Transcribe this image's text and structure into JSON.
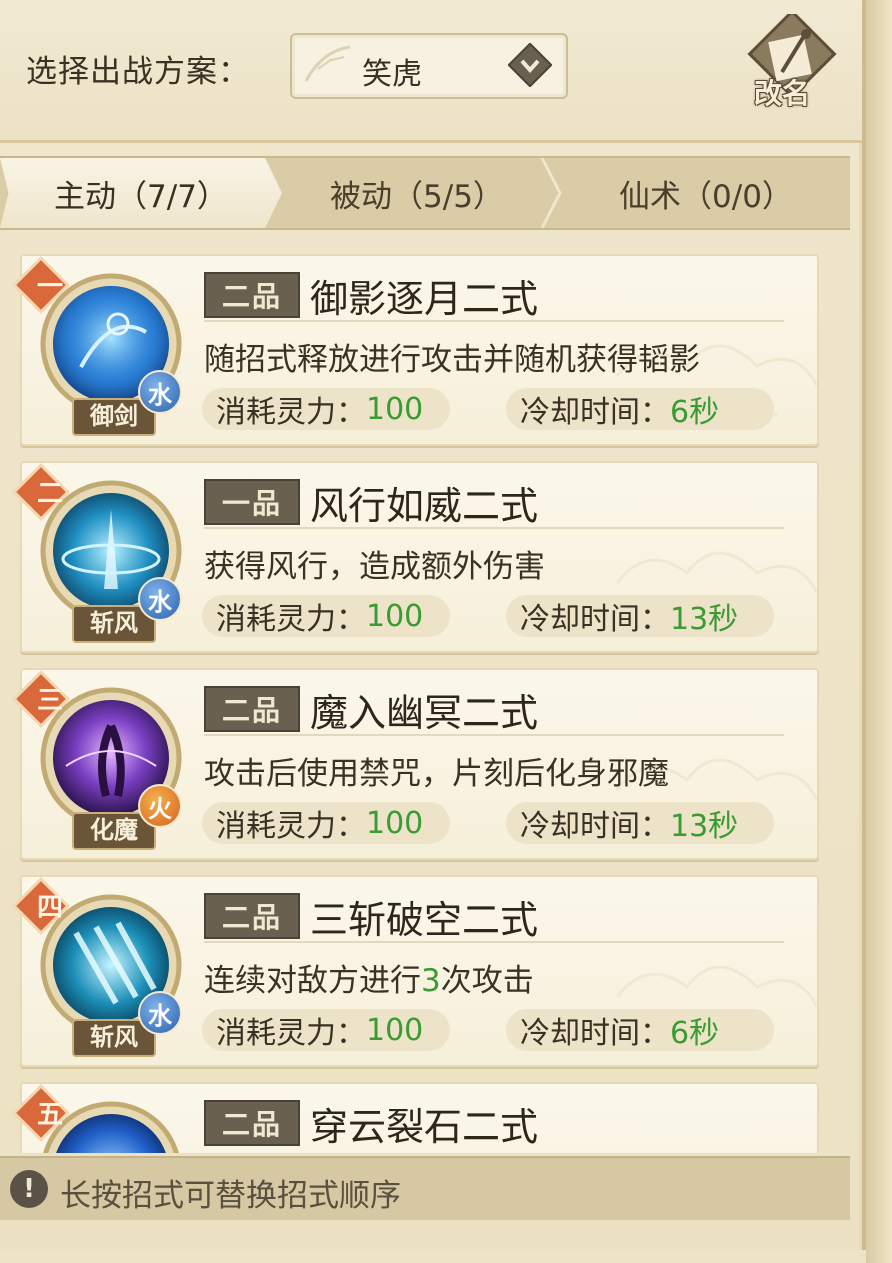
{
  "header": {
    "scheme_label": "选择出战方案：",
    "scheme_value": "笑虎",
    "rename_label": "改名"
  },
  "tabs": [
    {
      "label": "主动（7/7）",
      "active": true
    },
    {
      "label": "被动（5/5）",
      "active": false
    },
    {
      "label": "仙术（0/0）",
      "active": false
    }
  ],
  "skills": [
    {
      "rank": "一",
      "icon_label": "御剑",
      "element": "水",
      "element_type": "water",
      "grade": "二品",
      "name": "御影逐月二式",
      "desc": "随招式释放进行攻击并随机获得韬影",
      "cost_label": "消耗灵力：",
      "cost": "100",
      "cd_label": "冷却时间：",
      "cd": "6秒",
      "icon_color": "#2a7fd6"
    },
    {
      "rank": "二",
      "icon_label": "斩风",
      "element": "水",
      "element_type": "water",
      "grade": "一品",
      "name": "风行如威二式",
      "desc": "获得风行，造成额外伤害",
      "cost_label": "消耗灵力：",
      "cost": "100",
      "cd_label": "冷却时间：",
      "cd": "13秒",
      "icon_color": "#1f8fc2"
    },
    {
      "rank": "三",
      "icon_label": "化魔",
      "element": "火",
      "element_type": "fire",
      "grade": "二品",
      "name": "魔入幽冥二式",
      "desc": "攻击后使用禁咒，片刻后化身邪魔",
      "cost_label": "消耗灵力：",
      "cost": "100",
      "cd_label": "冷却时间：",
      "cd": "13秒",
      "icon_color": "#7a3fc2"
    },
    {
      "rank": "四",
      "icon_label": "斩风",
      "element": "水",
      "element_type": "water",
      "grade": "二品",
      "name": "三斩破空二式",
      "desc_pre": "连续对敌方进行",
      "desc_hl": "3",
      "desc_post": "次攻击",
      "cost_label": "消耗灵力：",
      "cost": "100",
      "cd_label": "冷却时间：",
      "cd": "6秒",
      "icon_color": "#1c8fb8"
    },
    {
      "rank": "五",
      "grade": "二品",
      "name": "穿云裂石二式",
      "icon_color": "#1f5fc8"
    }
  ],
  "tip": "长按招式可替换招式顺序",
  "colors": {
    "accent_green": "#3b9b33",
    "badge_orange": "#d9683a",
    "panel_bg": "#efe6cc"
  }
}
